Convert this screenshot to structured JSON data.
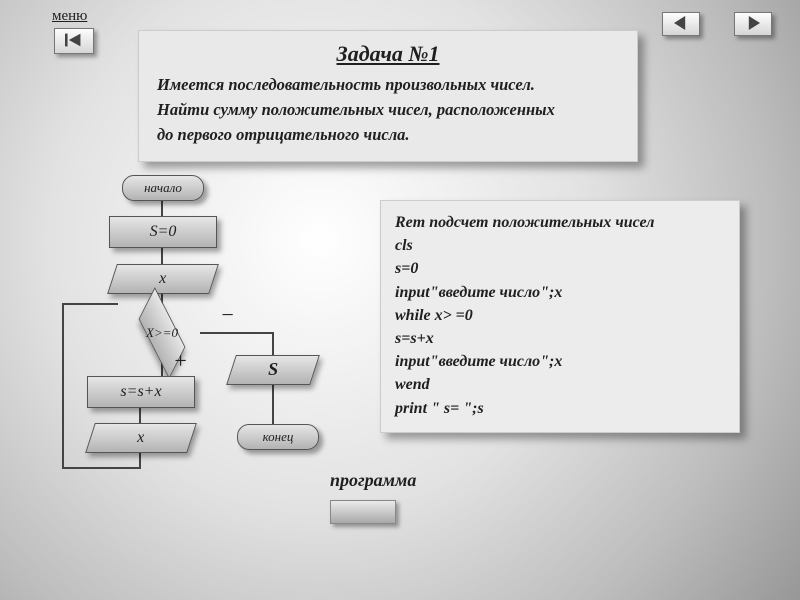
{
  "menu_label": "меню",
  "task": {
    "title": "Задача №1",
    "line1": "Имеется последовательность произвольных чисел.",
    "line2": "Найти сумму положительных чисел, расположенных",
    "line3": "до первого отрицательного числа."
  },
  "flow": {
    "start": "начало",
    "init": "S=0",
    "input1": "x",
    "decision": "X>=0",
    "sum": "s=s+x",
    "input2": "x",
    "output": "S",
    "end": "конец",
    "branch_negative": "−",
    "branch_positive": "+"
  },
  "code": {
    "l1": "Rem подсчет положительных чисел",
    "l2": "cls",
    "l3": "s=0",
    "l4": "input\"введите число\";x",
    "l5": "while x> =0",
    "l6": "s=s+x",
    "l7": "input\"введите число\";x",
    "l8": "wend",
    "l9": "print \" s= \";s"
  },
  "program_label": "программа"
}
